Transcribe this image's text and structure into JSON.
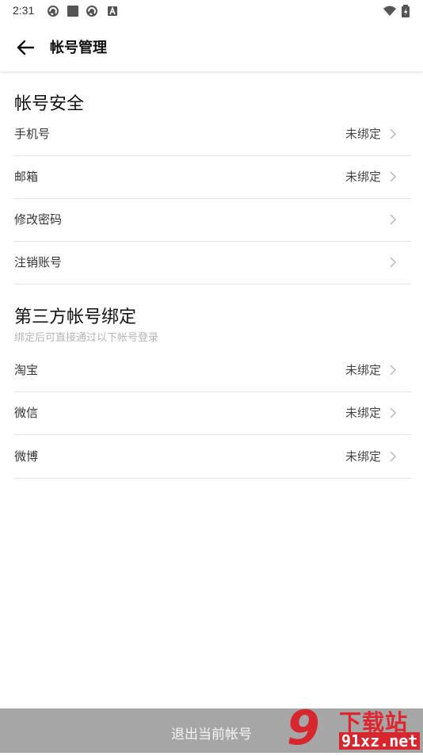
{
  "status_bar": {
    "time": "2:31"
  },
  "app_bar": {
    "title": "帐号管理"
  },
  "account_security": {
    "title": "帐号安全",
    "rows": [
      {
        "label": "手机号",
        "value": "未绑定"
      },
      {
        "label": "邮箱",
        "value": "未绑定"
      },
      {
        "label": "修改密码",
        "value": ""
      },
      {
        "label": "注销账号",
        "value": ""
      }
    ]
  },
  "third_party": {
    "title": "第三方帐号绑定",
    "subtitle": "绑定后可直接通过以下帐号登录",
    "rows": [
      {
        "label": "淘宝",
        "value": "未绑定"
      },
      {
        "label": "微信",
        "value": "未绑定"
      },
      {
        "label": "微博",
        "value": "未绑定"
      }
    ]
  },
  "footer": {
    "logout_label": "退出当前帐号"
  },
  "watermark": {
    "logo": "9",
    "name": "下载站",
    "domain": "91xz.net"
  }
}
